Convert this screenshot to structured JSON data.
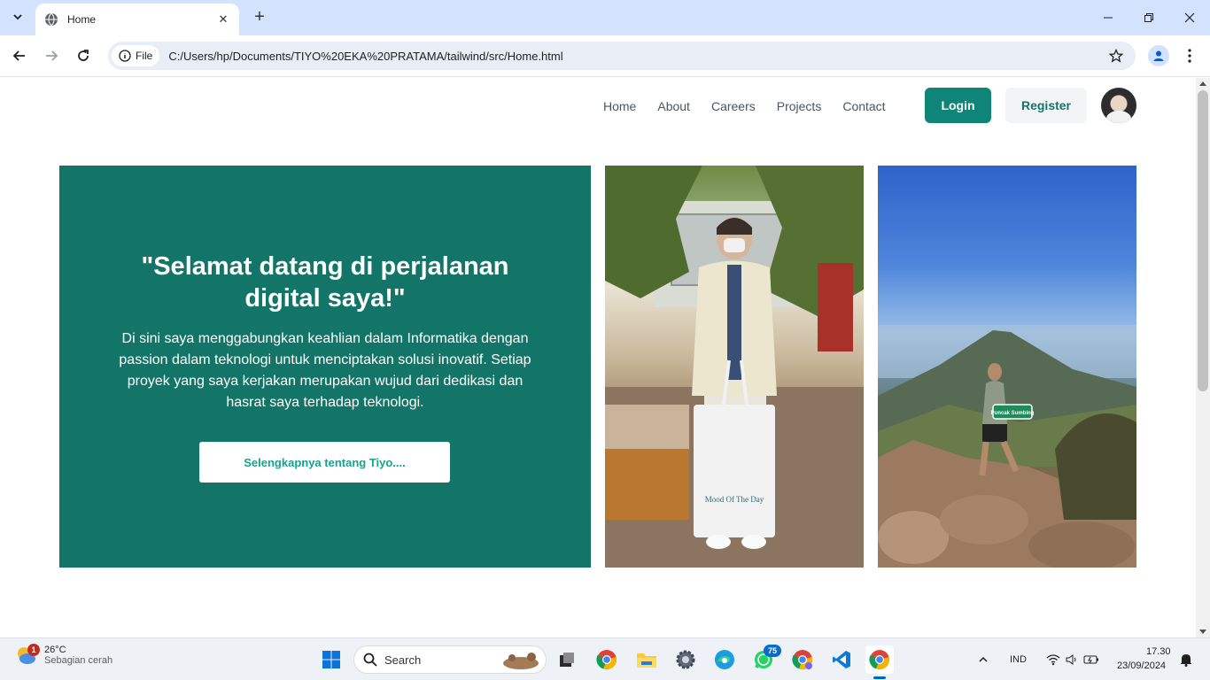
{
  "browser": {
    "tab_title": "Home",
    "address_chip": "File",
    "url": "C:/Users/hp/Documents/TIYO%20EKA%20PRATAMA/tailwind/src/Home.html"
  },
  "site": {
    "nav": [
      "Home",
      "About",
      "Careers",
      "Projects",
      "Contact"
    ],
    "login_label": "Login",
    "register_label": "Register"
  },
  "hero": {
    "title": "\"Selamat datang di perjalanan digital saya!\"",
    "text": "Di sini saya menggabungkan keahlian dalam Informatika dengan passion dalam teknologi untuk menciptakan solusi inovatif. Setiap proyek yang saya kerjakan merupakan wujud dari dedikasi dan hasrat saya terhadap teknologi.",
    "button_label": "Selengkapnya tentang Tiyo...."
  },
  "photos": {
    "photo1_bag_text": "Mood Of The Day",
    "photo2_sign_text": "Puncak Sumbing"
  },
  "taskbar": {
    "weather_temp": "26°C",
    "weather_desc": "Sebagian cerah",
    "weather_badge": "1",
    "search_label": "Search",
    "whatsapp_badge": "75",
    "language": "IND",
    "time": "17.30",
    "date": "23/09/2024"
  },
  "colors": {
    "brand_green": "#137567",
    "login_bg": "#0f8577",
    "chrome_frame": "#d3e3fd"
  }
}
